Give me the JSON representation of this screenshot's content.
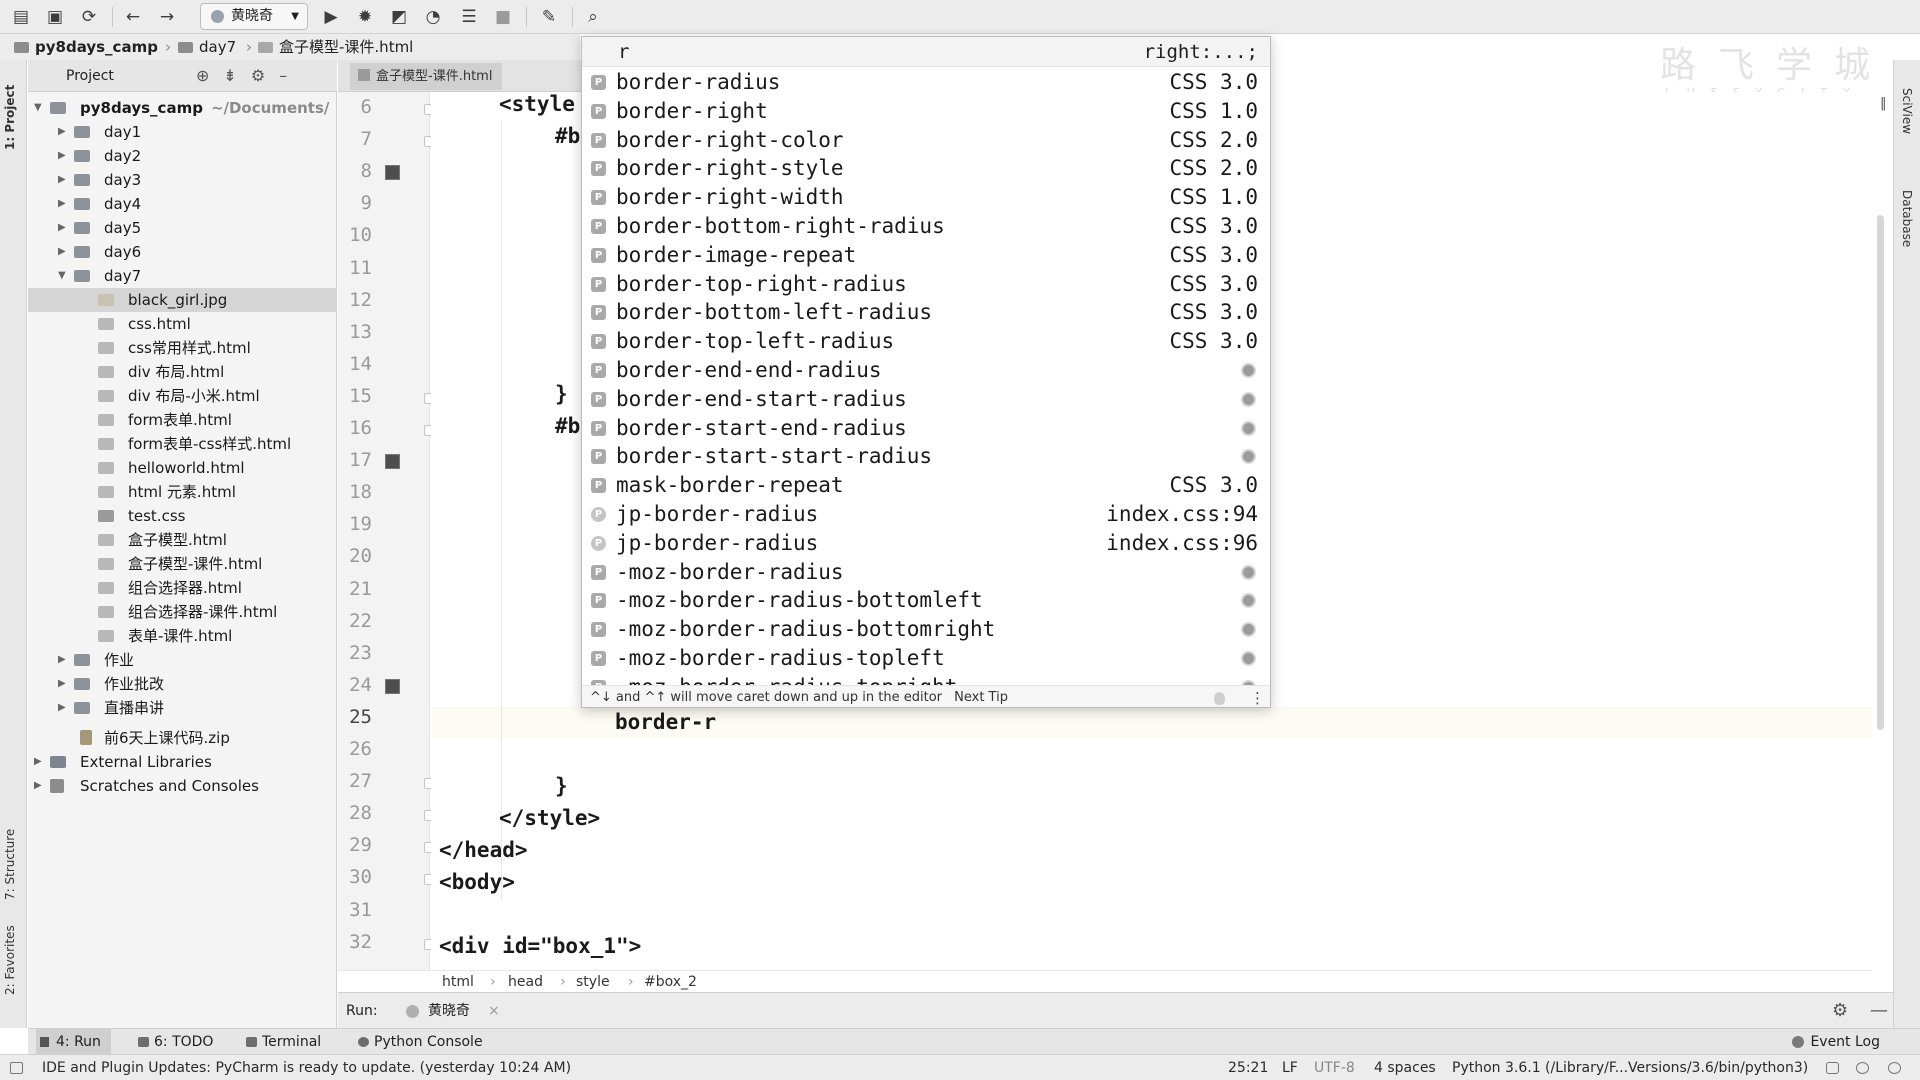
{
  "toolbar": {
    "run_config": "黄晓奇",
    "icons": [
      "open-folder-icon",
      "save-icon",
      "sync-icon",
      "back-icon",
      "forward-icon",
      "run-icon",
      "debug-icon",
      "coverage-icon",
      "profile-icon",
      "concurrency-icon",
      "stop-icon",
      "settings-wrench-icon",
      "search-icon"
    ]
  },
  "breadcrumb": {
    "items": [
      "py8days_camp",
      "day7",
      "盒子模型-课件.html"
    ]
  },
  "watermark": {
    "brand": "路飞学城",
    "sub": "LUFFYCITY"
  },
  "left_strip": {
    "project_tab": "1: Project",
    "structure_tab": "7: Structure",
    "favorites_tab": "2: Favorites"
  },
  "right_strip": {
    "sciview_tab": "SciView",
    "database_tab": "Database"
  },
  "project": {
    "header_label": "Project",
    "root": {
      "name": "py8days_camp",
      "path": "~/Documents/"
    },
    "folders": [
      "day1",
      "day2",
      "day3",
      "day4",
      "day5",
      "day6",
      "day7"
    ],
    "day7_files": [
      "black_girl.jpg",
      "css.html",
      "css常用样式.html",
      "div 布局.html",
      "div 布局-小米.html",
      "form表单.html",
      "form表单-css样式.html",
      "helloworld.html",
      "html 元素.html",
      "test.css",
      "盒子模型.html",
      "盒子模型-课件.html",
      "组合选择器.html",
      "组合选择器-课件.html",
      "表单-课件.html"
    ],
    "more_folders": [
      "作业",
      "作业批改",
      "直播串讲"
    ],
    "zip_file": "前6天上课代码.zip",
    "external_libraries": "External Libraries",
    "scratches": "Scratches and Consoles"
  },
  "editor": {
    "tab_label": "盒子模型-课件.html",
    "line_numbers": [
      "6",
      "7",
      "8",
      "9",
      "10",
      "11",
      "12",
      "13",
      "14",
      "15",
      "16",
      "17",
      "18",
      "19",
      "20",
      "21",
      "22",
      "23",
      "24",
      "25",
      "26",
      "27",
      "28",
      "29",
      "30",
      "31",
      "32"
    ],
    "current_line": "25",
    "code": {
      "l6": "<style",
      "l7": "#b",
      "l16": "#b",
      "l15": "}",
      "l25": "border-r",
      "l27": "}",
      "l28": "</style>",
      "l29": "</head>",
      "l30": "<body>",
      "l32": "<div id=\"box_1\">"
    }
  },
  "completion": {
    "query": "r",
    "hint": "right:...;",
    "items": [
      {
        "name": "border-radius",
        "tail": "CSS 3.0"
      },
      {
        "name": "border-right",
        "tail": "CSS 1.0"
      },
      {
        "name": "border-right-color",
        "tail": "CSS 2.0"
      },
      {
        "name": "border-right-style",
        "tail": "CSS 2.0"
      },
      {
        "name": "border-right-width",
        "tail": "CSS 1.0"
      },
      {
        "name": "border-bottom-right-radius",
        "tail": "CSS 3.0"
      },
      {
        "name": "border-image-repeat",
        "tail": "CSS 3.0"
      },
      {
        "name": "border-top-right-radius",
        "tail": "CSS 3.0"
      },
      {
        "name": "border-bottom-left-radius",
        "tail": "CSS 3.0"
      },
      {
        "name": "border-top-left-radius",
        "tail": "CSS 3.0"
      },
      {
        "name": "border-end-end-radius",
        "tail": ""
      },
      {
        "name": "border-end-start-radius",
        "tail": ""
      },
      {
        "name": "border-start-end-radius",
        "tail": ""
      },
      {
        "name": "border-start-start-radius",
        "tail": ""
      },
      {
        "name": "mask-border-repeat",
        "tail": "CSS 3.0"
      },
      {
        "name": "jp-border-radius",
        "tail": "index.css:94"
      },
      {
        "name": "jp-border-radius",
        "tail": "index.css:96"
      },
      {
        "name": "-moz-border-radius",
        "tail": ""
      },
      {
        "name": "-moz-border-radius-bottomleft",
        "tail": ""
      },
      {
        "name": "-moz-border-radius-bottomright",
        "tail": ""
      },
      {
        "name": "-moz-border-radius-topleft",
        "tail": ""
      },
      {
        "name": "-moz-border-radius-topright",
        "tail": ""
      }
    ],
    "footer_text": "^↓ and ^↑ will move caret down and up in the editor",
    "footer_link": "Next Tip"
  },
  "code_breadcrumbs": [
    "html",
    "head",
    "style",
    "#box_2"
  ],
  "run_bar": {
    "label": "Run:",
    "tab": "黄晓奇"
  },
  "tool_windows": {
    "run": "4: Run",
    "todo": "6: TODO",
    "terminal": "Terminal",
    "python_console": "Python Console",
    "event_log": "Event Log"
  },
  "status_bar": {
    "message": "IDE and Plugin Updates: PyCharm is ready to update. (yesterday 10:24 AM)",
    "position": "25:21",
    "line_sep": "LF",
    "encoding": "UTF-8",
    "indent": "4 spaces",
    "interpreter": "Python 3.6.1 (/Library/F...Versions/3.6/bin/python3)"
  }
}
